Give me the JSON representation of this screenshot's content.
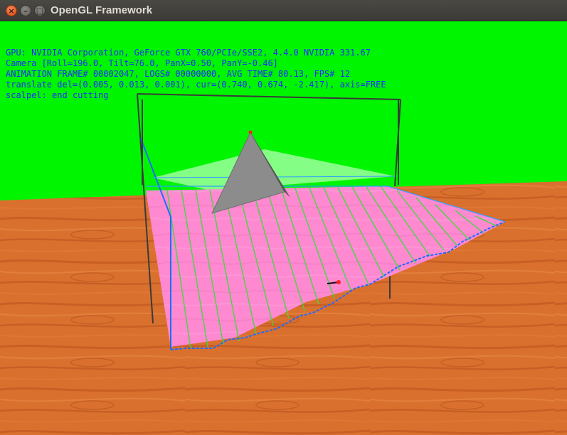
{
  "window": {
    "title": "OpenGL Framework",
    "close_glyph": "×",
    "minimize_glyph": "–",
    "maximize_glyph": "□"
  },
  "hud": {
    "gpu_line": "GPU: NVIDIA Corporation, GeForce GTX 760/PCIe/SSE2, 4.4.0 NVIDIA 331.67",
    "camera_line": "Camera [Roll=196.0, Tilt=76.0, PanX=0.50, PanY=-0.46]",
    "animation_line": "ANIMATION FRAME# 00002047, LOGS# 00000000, AVG TIME# 80.13, FPS# 12",
    "translate_line": "translate del=(0.005, 0.013, 0.001), cur=(0.740, 0.674, -2.417), axis=FREE",
    "status_line": "scalpel: end cutting"
  },
  "colors": {
    "background": "#00f500",
    "floor": "#d9702e",
    "tissue": "#ff8ad4",
    "hud_text": "#1a2cff",
    "cut_edge": "#1e6cff",
    "fiber": "#3cdc3c",
    "pyramid": "#8a8a8a"
  }
}
